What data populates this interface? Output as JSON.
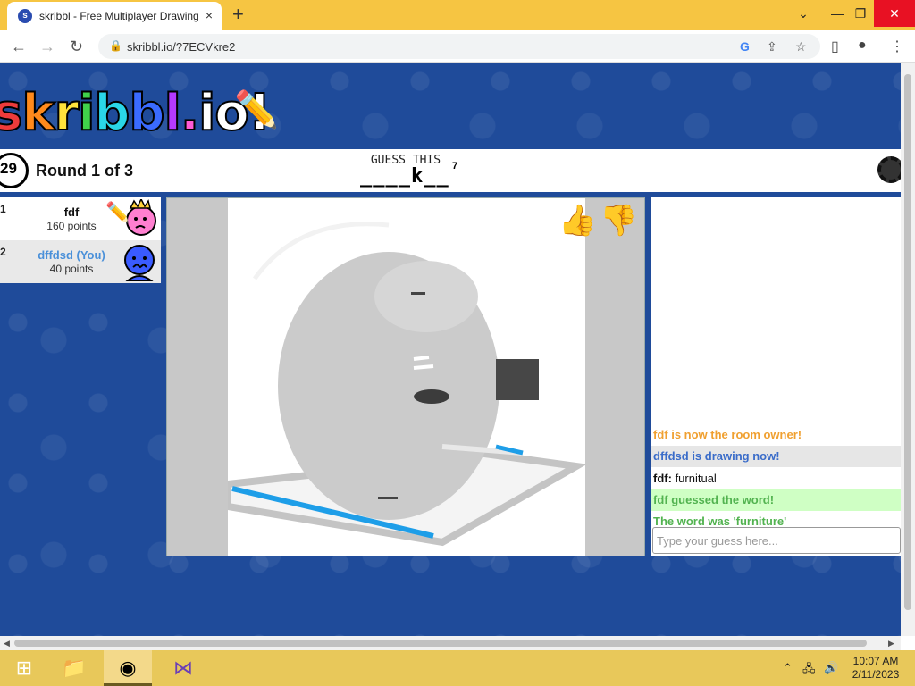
{
  "browser": {
    "tab_title": "skribbl - Free Multiplayer Drawing",
    "tab_close": "×",
    "new_tab": "+",
    "url": "skribbl.io/?7ECVkre2",
    "window_controls": {
      "minimize": "—",
      "maximize": "❐",
      "close": "✕",
      "collapse": "⌄"
    }
  },
  "game": {
    "logo_letters": [
      "s",
      "k",
      "r",
      "i",
      "b",
      "b",
      "l",
      ".",
      "i",
      "o",
      "!"
    ],
    "logo_colors": [
      "#ee3b3b",
      "#ff8a1c",
      "#ffe23b",
      "#40d14a",
      "#2ad6e8",
      "#3a6bff",
      "#b53aff",
      "#ff5ad4",
      "#ffffff",
      "#ffffff",
      "#ffffff"
    ],
    "timer": "29",
    "round_text": "Round 1 of 3",
    "guess_label": "GUESS THIS",
    "word_hint": "____k__",
    "word_length": "7",
    "players": [
      {
        "rank": "1",
        "name": "fdf",
        "points": "160 points",
        "name_color": "#111111",
        "bg": "#ffffff"
      },
      {
        "rank": "2",
        "name": "dffdsd (You)",
        "points": "40 points",
        "name_color": "#4a90d9",
        "bg": "#e9e9e9"
      }
    ],
    "chat": [
      {
        "text": "fdf is now the room owner!",
        "color": "#f0a030",
        "bg": "#ffffff"
      },
      {
        "text": "dffdsd is drawing now!",
        "color": "#3a6cc9",
        "bg": "#e6e6e6"
      },
      {
        "sender": "fdf:",
        "text": "furnitual",
        "color": "#111111",
        "bg": "#ffffff"
      },
      {
        "text": "fdf guessed the word!",
        "color": "#52b350",
        "bg": "#cfffc4"
      },
      {
        "text": "The word was 'furniture'",
        "color": "#52b350",
        "bg": "#ffffff"
      }
    ],
    "chat_placeholder": "Type your guess here..."
  },
  "taskbar": {
    "time": "10:07 AM",
    "date": "2/11/2023"
  },
  "colors": {
    "page_bg": "#1f4b9a",
    "taskbar": "#e8c85a",
    "tab_bar": "#f6c542"
  }
}
